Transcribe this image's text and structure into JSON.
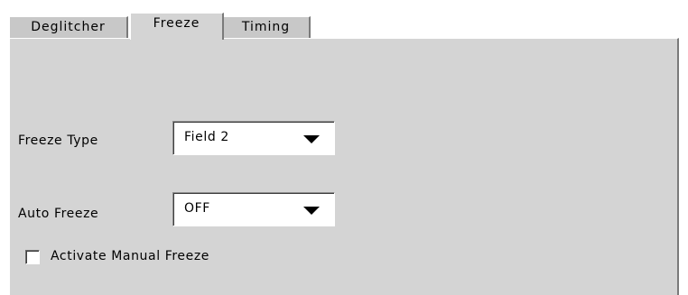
{
  "tabs": [
    {
      "label": "Deglitcher",
      "active": false
    },
    {
      "label": "Freeze",
      "active": true
    },
    {
      "label": "Timing",
      "active": false
    }
  ],
  "freeze_type": {
    "label": "Freeze Type",
    "value": "Field 2"
  },
  "auto_freeze": {
    "label": "Auto Freeze",
    "value": "OFF"
  },
  "manual_freeze": {
    "label": "Activate Manual Freeze",
    "checked": false
  },
  "colors": {
    "panel_background": "#d4d4d4",
    "tab_background": "#c8c8c8"
  }
}
